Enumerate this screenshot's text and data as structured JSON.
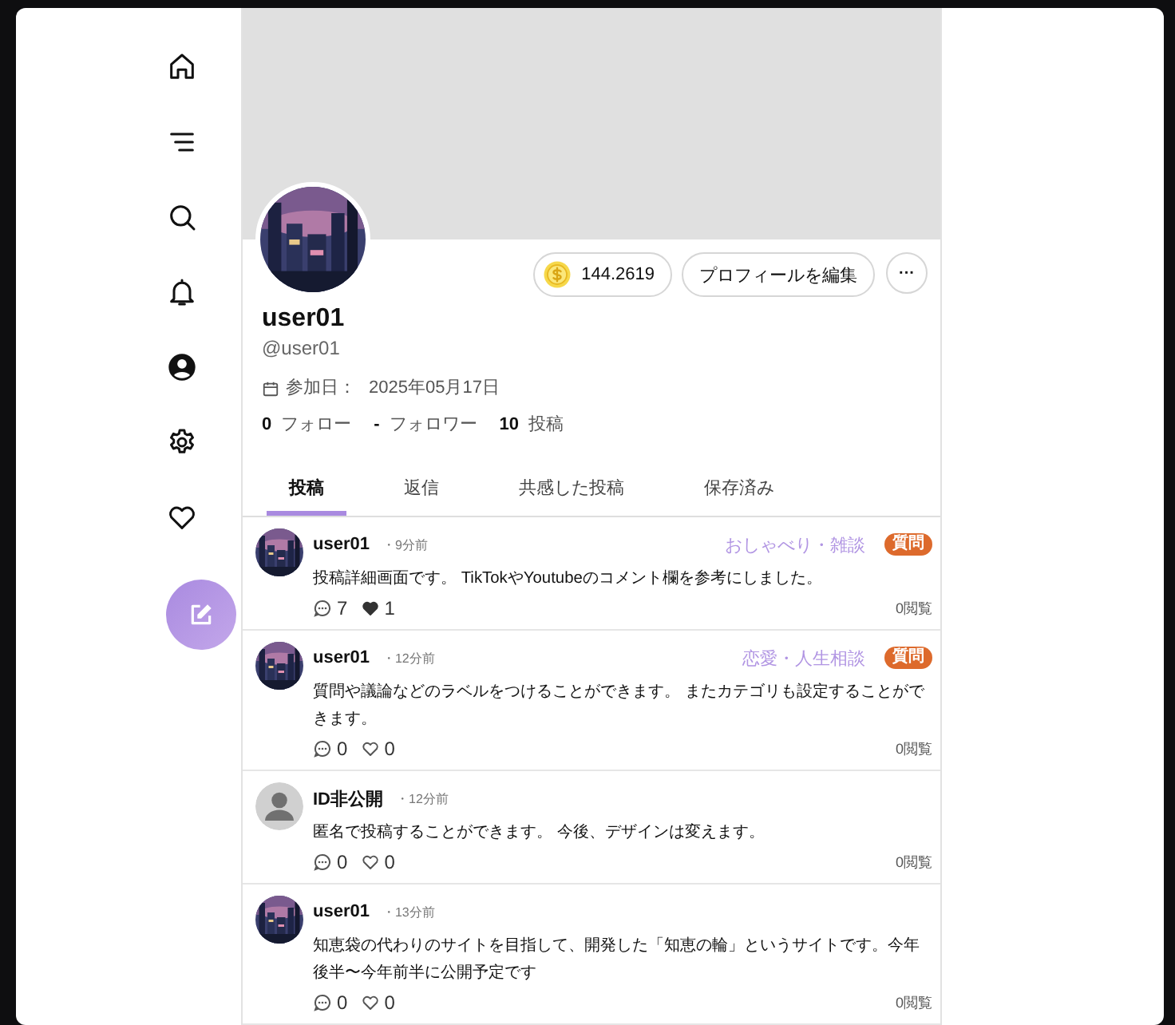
{
  "nav": [
    {
      "kind": "home"
    },
    {
      "kind": "menu"
    },
    {
      "kind": "search"
    },
    {
      "kind": "bell"
    },
    {
      "kind": "user"
    },
    {
      "kind": "gear"
    },
    {
      "kind": "heart"
    },
    {
      "kind": "compose"
    }
  ],
  "profile": {
    "coins": "144.2619",
    "edit_button": "プロフィールを編集",
    "more_button": "···",
    "name": "user01",
    "handle": "@user01",
    "joined_label": "参加日：",
    "joined_date": "2025年05月17日",
    "stats": [
      {
        "count": "0",
        "label": "フォロー"
      },
      {
        "count": "-",
        "label": "フォロワー"
      },
      {
        "count": "10",
        "label": "投稿"
      }
    ]
  },
  "tabs": [
    {
      "label": "投稿",
      "selected": true
    },
    {
      "label": "返信",
      "selected": false
    },
    {
      "label": "共感した投稿",
      "selected": false
    },
    {
      "label": "保存済み",
      "selected": false
    }
  ],
  "posts": [
    {
      "anonymous": false,
      "user": "user01",
      "time": "・9分前",
      "category": "おしゃべり・雑談",
      "label": "質問",
      "body": "投稿詳細画面です。 TikTokやYoutubeのコメント欄を参考にしました。",
      "comments": "7",
      "likes": "1",
      "liked": true,
      "views": "0閲覧"
    },
    {
      "anonymous": false,
      "user": "user01",
      "time": "・12分前",
      "category": "恋愛・人生相談",
      "label": "質問",
      "body": "質問や議論などのラベルをつけることができます。 またカテゴリも設定することができます。",
      "comments": "0",
      "likes": "0",
      "liked": false,
      "views": "0閲覧"
    },
    {
      "anonymous": true,
      "user": "ID非公開",
      "time": "・12分前",
      "body": "匿名で投稿することができます。 今後、デザインは変えます。",
      "comments": "0",
      "likes": "0",
      "liked": false,
      "views": "0閲覧"
    },
    {
      "anonymous": false,
      "user": "user01",
      "time": "・13分前",
      "body": "知恵袋の代わりのサイトを目指して、開発した「知恵の輪」というサイトです。今年後半〜今年前半に公開予定です",
      "comments": "0",
      "likes": "0",
      "liked": false,
      "views": "0閲覧"
    }
  ]
}
